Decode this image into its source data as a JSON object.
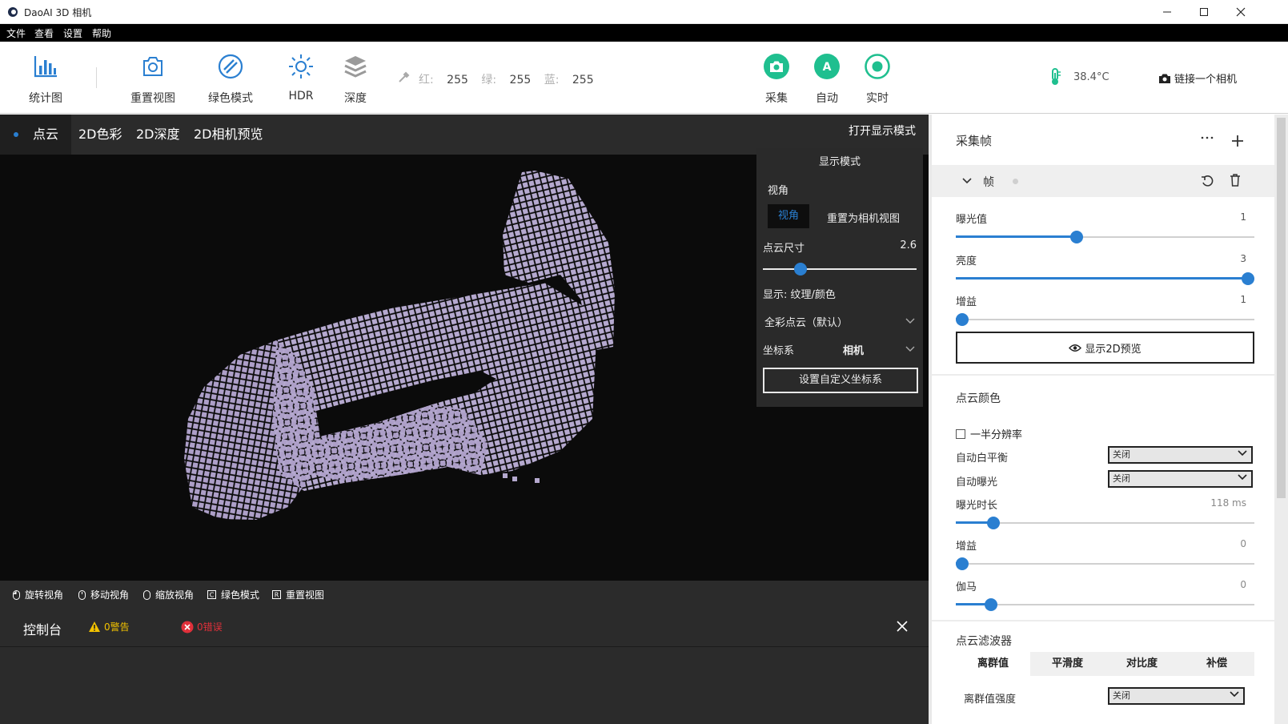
{
  "window": {
    "title": "DaoAI 3D 相机"
  },
  "menu": [
    "文件",
    "查看",
    "设置",
    "帮助"
  ],
  "toolbar": {
    "stats": "统计图",
    "reset_view": "重置视图",
    "green_mode": "绿色模式",
    "hdr": "HDR",
    "depth": "深度",
    "rgb": {
      "r_label": "红:",
      "r": "255",
      "g_label": "绿:",
      "g": "255",
      "b_label": "蓝:",
      "b": "255"
    },
    "capture": "采集",
    "auto": "自动",
    "live": "实时",
    "temperature": "38.4°C",
    "connect": "链接一个相机"
  },
  "view_tabs": [
    "点云",
    "2D色彩",
    "2D深度",
    "2D相机预览"
  ],
  "open_display_mode": "打开显示模式",
  "display_panel": {
    "title": "显示模式",
    "view_label": "视角",
    "view_button": "视角",
    "reset_camera_view": "重置为相机视图",
    "point_size_label": "点云尺寸",
    "point_size_value": "2.6",
    "point_size_frac": 0.22,
    "texture_label": "显示: 纹理/颜色",
    "color_mode": "全彩点云（默认）",
    "coord_label": "坐标系",
    "coord_value": "相机",
    "custom_coord_button": "设置自定义坐标系"
  },
  "nav": [
    "旋转视角",
    "移动视角",
    "缩放视角",
    "绿色模式",
    "重置视图"
  ],
  "console": {
    "title": "控制台",
    "warnings": "0警告",
    "errors": "0错误"
  },
  "right_panel": {
    "capture_frame": "采集帧",
    "frame_label": "帧",
    "exposure_label": "曝光值",
    "exposure_value": "1",
    "exposure_frac": 0.4,
    "brightness_label": "亮度",
    "brightness_value": "3",
    "brightness_frac": 1.0,
    "gain_label": "增益",
    "gain_value": "1",
    "gain_frac": 0.0,
    "show_2d_preview": "显示2D预览",
    "point_color_title": "点云颜色",
    "half_res": "一半分辨率",
    "auto_wb_label": "自动白平衡",
    "auto_wb_value": "关闭",
    "auto_exp_label": "自动曝光",
    "auto_exp_value": "关闭",
    "exp_time_label": "曝光时长",
    "exp_time_value": "118 ms",
    "exp_time_frac": 0.11,
    "gain2_label": "增益",
    "gain2_value": "0",
    "gain2_frac": 0.0,
    "gamma_label": "伽马",
    "gamma_value": "0",
    "gamma_frac": 0.1,
    "filter_title": "点云滤波器",
    "filter_tabs": [
      "离群值",
      "平滑度",
      "对比度",
      "补偿"
    ],
    "outlier_label": "离群值强度",
    "outlier_value": "关闭"
  },
  "colors": {
    "accent": "#2a7fd1",
    "green": "#1fbf8f",
    "dark": "#2b2b2b",
    "cloud": "#b5a9cf"
  }
}
